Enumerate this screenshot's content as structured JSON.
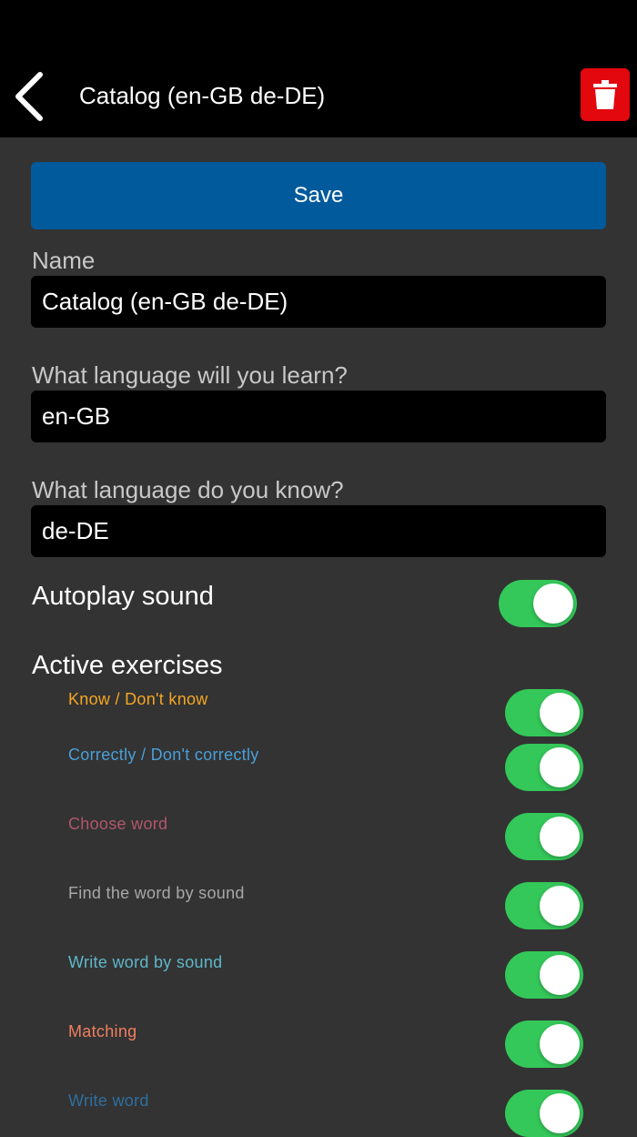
{
  "header": {
    "title": "Catalog (en-GB de-DE)",
    "back_icon": "chevron-left-icon",
    "delete_icon": "trash-icon",
    "delete_color": "#e3070e"
  },
  "form": {
    "save_label": "Save",
    "save_color": "#005a9c",
    "name_label": "Name",
    "name_value": "Catalog (en-GB de-DE)",
    "learn_label": "What language will you learn?",
    "learn_value": "en-GB",
    "know_label": "What language do you know?",
    "know_value": "de-DE",
    "autoplay_label": "Autoplay sound",
    "autoplay_on": true
  },
  "exercises": {
    "title": "Active exercises",
    "toggle_color": "#34c759",
    "items": [
      {
        "label": "Know / Don't know",
        "color": "#f5a623",
        "on": true
      },
      {
        "label": "Correctly / Don't correctly",
        "color": "#4a9fd8",
        "on": true
      },
      {
        "label": "Choose word",
        "color": "#b0566e",
        "on": true
      },
      {
        "label": "Find the word by sound",
        "color": "#a8a8a8",
        "on": true
      },
      {
        "label": "Write word by sound",
        "color": "#5fb7c9",
        "on": true
      },
      {
        "label": "Matching",
        "color": "#f07f5f",
        "on": true
      },
      {
        "label": "Write word",
        "color": "#2f6f9f",
        "on": true
      }
    ]
  }
}
